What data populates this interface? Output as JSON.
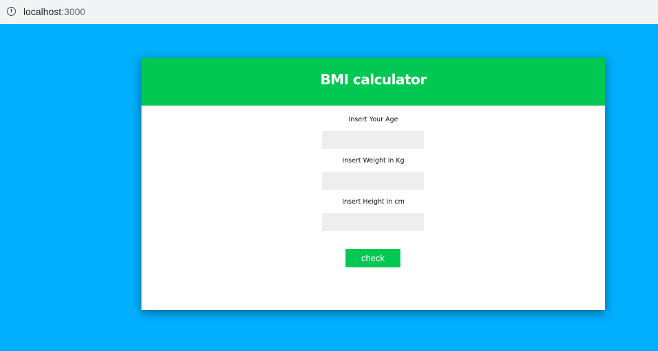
{
  "browser": {
    "url_host": "localhost",
    "url_port": ":3000",
    "info_icon_glyph": "i"
  },
  "calculator": {
    "title": "BMI calculator",
    "fields": [
      {
        "label": "Insert Your Age",
        "value": "",
        "placeholder": ""
      },
      {
        "label": "Insert Weight in Kg",
        "value": "",
        "placeholder": ""
      },
      {
        "label": "Insert Height in cm",
        "value": "",
        "placeholder": ""
      }
    ],
    "check_label": "check"
  },
  "colors": {
    "page_background": "#00b0ff",
    "accent_green": "#00c853",
    "input_background": "#eeeeee"
  }
}
